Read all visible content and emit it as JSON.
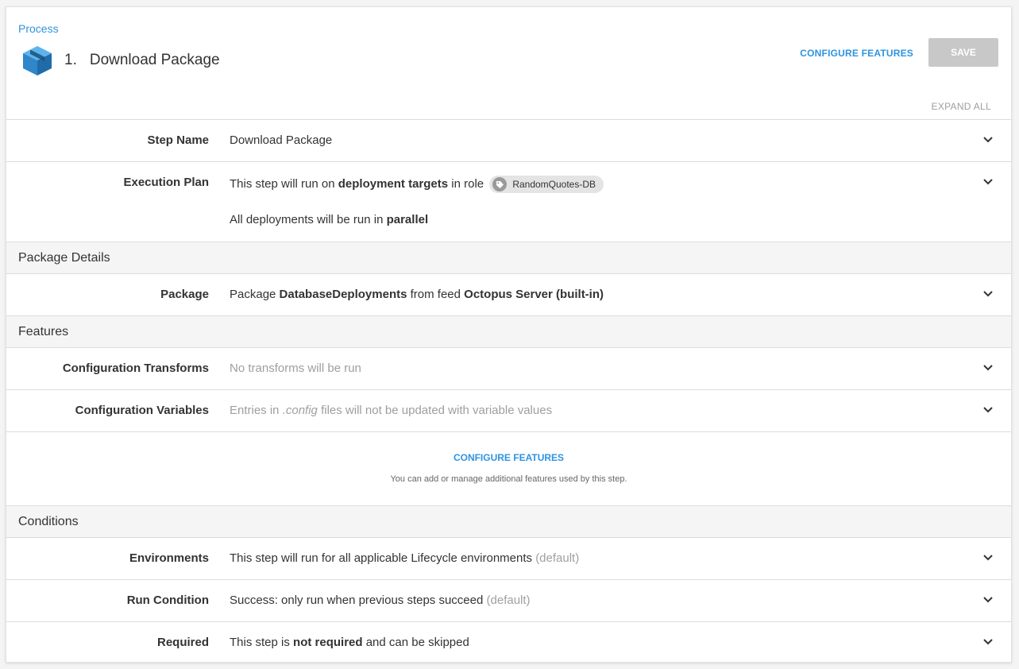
{
  "breadcrumb": "Process",
  "step": {
    "number": "1.",
    "title": "Download Package",
    "icon": "package-box-icon"
  },
  "toolbar": {
    "configure_features": "CONFIGURE FEATURES",
    "save": "SAVE",
    "expand_all": "EXPAND ALL"
  },
  "rows": {
    "step_name": {
      "label": "Step Name",
      "value": "Download Package"
    },
    "execution_plan": {
      "label": "Execution Plan",
      "line1_prefix": "This step will run on ",
      "line1_bold": "deployment targets",
      "line1_mid": " in role",
      "role_chip": "RandomQuotes-DB",
      "line2_prefix": "All deployments will be run in ",
      "line2_bold": "parallel"
    },
    "package": {
      "label": "Package",
      "prefix": "Package ",
      "package_name": "DatabaseDeployments",
      "mid": " from feed ",
      "feed": "Octopus Server (built-in)"
    },
    "config_transforms": {
      "label": "Configuration Transforms",
      "value": "No transforms will be run"
    },
    "config_variables": {
      "label": "Configuration Variables",
      "prefix": "Entries in ",
      "italic": ".config",
      "suffix": " files will not be updated with variable values"
    },
    "environments": {
      "label": "Environments",
      "value": "This step will run for all applicable Lifecycle environments",
      "default": "(default)"
    },
    "run_condition": {
      "label": "Run Condition",
      "value": "Success: only run when previous steps succeed",
      "default": "(default)"
    },
    "required": {
      "label": "Required",
      "prefix": "This step is ",
      "bold": "not required",
      "suffix": " and can be skipped"
    }
  },
  "sections": {
    "package_details": "Package Details",
    "features": "Features",
    "conditions": "Conditions"
  },
  "features_block": {
    "link": "CONFIGURE FEATURES",
    "help": "You can add or manage additional features used by this step."
  },
  "colors": {
    "accent": "#2f93e0",
    "save_disabled": "#c8c8c8",
    "section_bg": "#f5f5f5"
  }
}
